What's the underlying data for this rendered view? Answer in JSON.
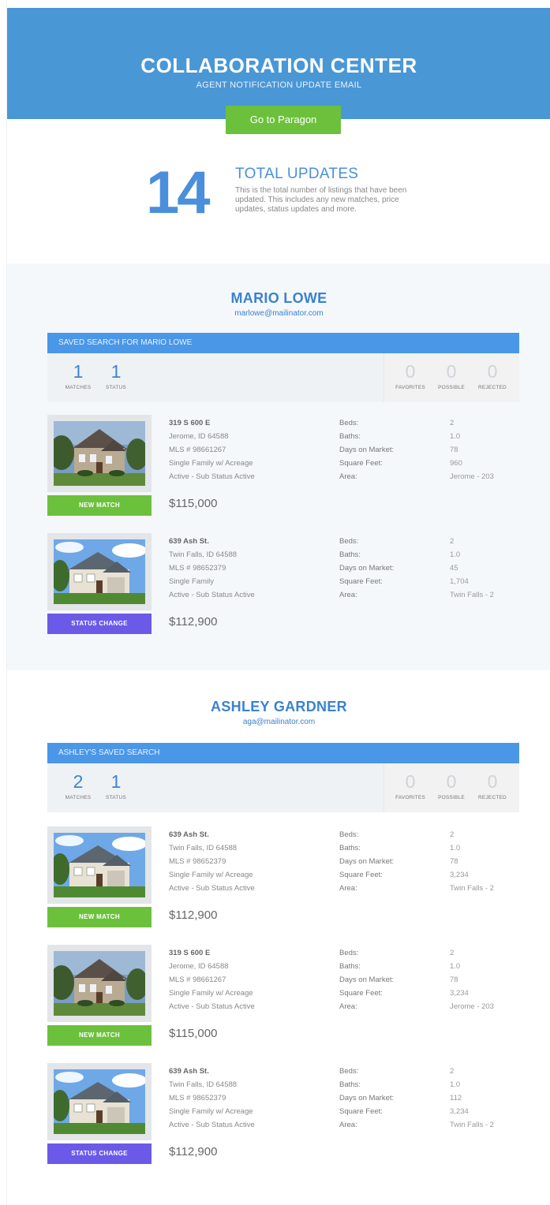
{
  "header": {
    "title": "COLLABORATION CENTER",
    "subtitle": "AGENT NOTIFICATION UPDATE EMAIL",
    "button_label": "Go to Paragon"
  },
  "summary": {
    "total": "14",
    "title": "TOTAL UPDATES",
    "description": "This is the total number of listings that have been updated.  This includes any new matches, price updates, status updates and more."
  },
  "colors": {
    "header_blue": "#4a97d6",
    "accent_blue": "#4a8fdb",
    "new_match_green": "#6cc13c",
    "status_change_purple": "#6b5ae8"
  },
  "detail_labels": {
    "beds": "Beds:",
    "baths": "Baths:",
    "days": "Days on Market:",
    "sqft": "Square Feet:",
    "area": "Area:"
  },
  "stat_labels": {
    "matches": "MATCHES",
    "status": "STATUS",
    "favorites": "FAVORITES",
    "possible": "POSSIBLE",
    "rejected": "REJECTED"
  },
  "agents": [
    {
      "name": "MARIO LOWE",
      "email": "marlowe@mailinator.com",
      "search_label": "SAVED SEARCH FOR MARIO LOWE",
      "stats": {
        "matches": "1",
        "status": "1",
        "favorites": "0",
        "possible": "0",
        "rejected": "0"
      },
      "listings": [
        {
          "address": "319 S 600 E",
          "city": "Jerome, ID  64588",
          "mls": "MLS # 98661267",
          "type": "Single Family w/ Acreage",
          "status": "Active - Sub Status Active",
          "price": "$115,000",
          "badge": "NEW MATCH",
          "beds": "2",
          "baths": "1.0",
          "days": "78",
          "sqft": "960",
          "area": "Jerome - 203"
        },
        {
          "address": "639 Ash St.",
          "city": "Twin Falls, ID 64588",
          "mls": "MLS # 98652379",
          "type": "Single Family",
          "status": "Active - Sub Status Active",
          "price": "$112,900",
          "badge": "STATUS CHANGE",
          "beds": "2",
          "baths": "1.0",
          "days": "45",
          "sqft": "1,704",
          "area": "Twin Falls - 2"
        }
      ]
    },
    {
      "name": "ASHLEY GARDNER",
      "email": "aga@mailinator.com",
      "search_label": "ASHLEY'S SAVED SEARCH",
      "stats": {
        "matches": "2",
        "status": "1",
        "favorites": "0",
        "possible": "0",
        "rejected": "0"
      },
      "listings": [
        {
          "address": "639 Ash St.",
          "city": "Twin Falls, ID 64588",
          "mls": "MLS # 98652379",
          "type": "Single Family w/ Acreage",
          "status": "Active - Sub Status Active",
          "price": "$112,900",
          "badge": "NEW MATCH",
          "beds": "2",
          "baths": "1.0",
          "days": "78",
          "sqft": "3,234",
          "area": "Twin Falls - 2"
        },
        {
          "address": "319 S 600 E",
          "city": "Jerome, ID 64588",
          "mls": "MLS # 98661267",
          "type": "Single Family w/ Acreage",
          "status": "Active - Sub Status Active",
          "price": "$115,000",
          "badge": "NEW MATCH",
          "beds": "2",
          "baths": "1.0",
          "days": "78",
          "sqft": "3,234",
          "area": "Jerome - 203"
        },
        {
          "address": "639 Ash St.",
          "city": "Twin Falls, ID 64588",
          "mls": "MLS # 98652379",
          "type": "Single Family w/ Acreage",
          "status": "Active - Sub Status Active",
          "price": "$112,900",
          "badge": "STATUS CHANGE",
          "beds": "2",
          "baths": "1.0",
          "days": "112",
          "sqft": "3,234",
          "area": "Twin Falls - 2"
        }
      ]
    }
  ]
}
